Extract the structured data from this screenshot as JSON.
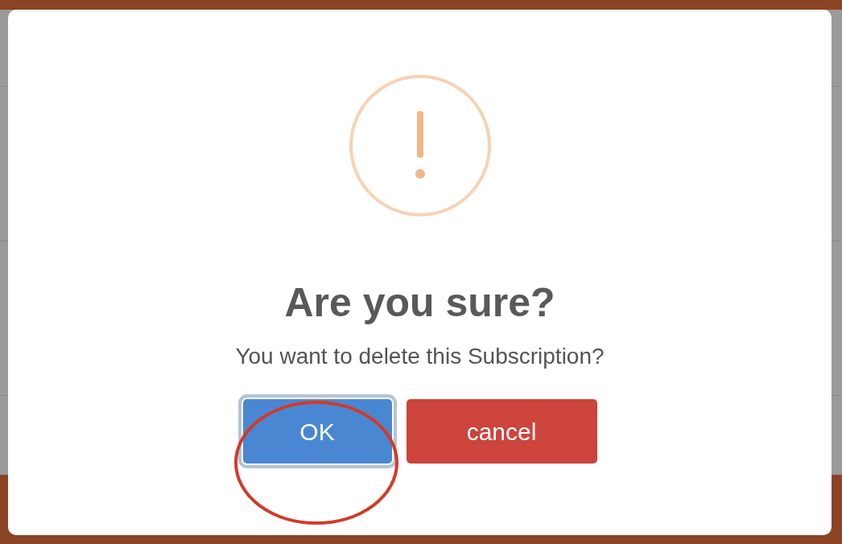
{
  "dialog": {
    "title": "Are you sure?",
    "message": "You want to delete this Subscription?",
    "buttons": [
      {
        "label": "OK",
        "kind": "confirm",
        "focused": true
      },
      {
        "label": "cancel",
        "kind": "cancel",
        "focused": false
      }
    ]
  }
}
